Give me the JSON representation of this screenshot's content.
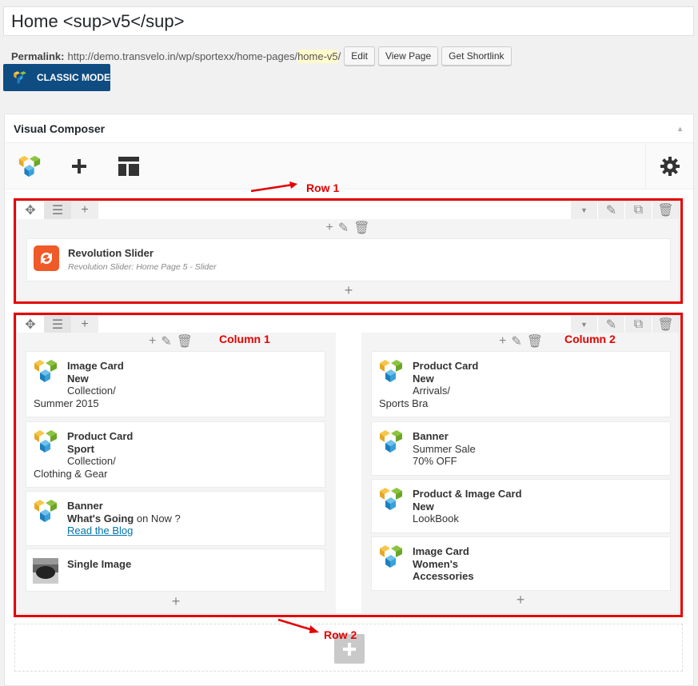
{
  "post_title": "Home <sup>v5</sup>",
  "permalink": {
    "label": "Permalink:",
    "url_base": "http://demo.transvelo.in/wp/sportexx/home-pages/",
    "slug": "home-v5",
    "trailing": "/",
    "edit_label": "Edit",
    "view_label": "View Page",
    "shortlink_label": "Get Shortlink"
  },
  "classic_mode_label": "CLASSIC MODE",
  "vc": {
    "title": "Visual Composer"
  },
  "annotations": {
    "row1": "Row 1",
    "row2": "Row 2",
    "col1": "Column 1",
    "col2": "Column 2"
  },
  "row1": {
    "element": {
      "name": "Revolution Slider",
      "desc": "Revolution Slider: Home Page 5 - Slider"
    }
  },
  "col1": [
    {
      "name": "Image Card",
      "l2": "New",
      "l3": "Collection/",
      "l4": "Summer 2015"
    },
    {
      "name": "Product Card",
      "l2": "Sport",
      "l3": "Collection/",
      "l4": "Clothing & Gear"
    },
    {
      "name": "Banner",
      "l2b": "What's Going",
      "l2r": " on Now ?",
      "l3": "Read the Blog"
    },
    {
      "name": "Single Image"
    }
  ],
  "col2": [
    {
      "name": "Product Card",
      "l2": "New",
      "l3": "Arrivals/",
      "l4": "Sports Bra"
    },
    {
      "name": "Banner",
      "l2": "Summer Sale",
      "l3": "70% OFF"
    },
    {
      "name": "Product & Image Card",
      "l2": "New",
      "l3": "LookBook"
    },
    {
      "name": "Image Card",
      "l2": "Women's",
      "l3": "Accessories"
    }
  ],
  "colors": {
    "accent_red": "#e40000",
    "vc_blue": "#0f4c81",
    "revslider_orange": "#f05a28"
  },
  "icons": [
    "vc-logo-icon",
    "plus-icon",
    "layout-icon",
    "gear-icon",
    "move-icon",
    "pencil-icon",
    "trash-icon",
    "clone-icon",
    "chevron-down-icon",
    "revslider-icon",
    "collapse-icon"
  ]
}
